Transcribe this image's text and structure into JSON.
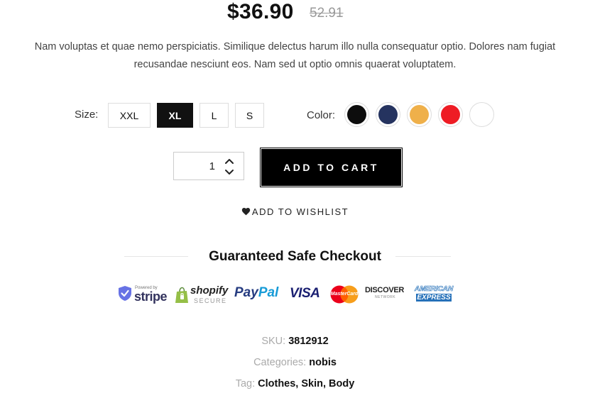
{
  "price": {
    "current": "$36.90",
    "original": "52.91"
  },
  "description": "Nam voluptas et quae nemo perspiciatis. Similique delectus harum illo nulla consequatur optio. Dolores nam fugiat recusandae nesciunt eos. Nam sed ut optio omnis quaerat voluptatem.",
  "size": {
    "label": "Size:",
    "options": [
      "XXL",
      "XL",
      "L",
      "S"
    ],
    "selected": "XL"
  },
  "color": {
    "label": "Color:",
    "swatches": [
      {
        "name": "black",
        "hex": "#0d0d0d"
      },
      {
        "name": "navy",
        "hex": "#25335f"
      },
      {
        "name": "yellow",
        "hex": "#efb04a"
      },
      {
        "name": "red",
        "hex": "#ee1c24"
      },
      {
        "name": "white",
        "hex": "#ffffff"
      }
    ]
  },
  "quantity": {
    "value": "1"
  },
  "buttons": {
    "add_to_cart": "ADD TO CART",
    "wishlist": "ADD TO WISHLIST"
  },
  "checkout": {
    "title": "Guaranteed Safe Checkout",
    "badges": {
      "stripe_small": "Powered by",
      "stripe": "stripe",
      "shopify": "shopify",
      "shopify_secure": "SECURE",
      "paypal_pay": "Pay",
      "paypal_pal": "Pal",
      "visa": "VISA",
      "mastercard": "MasterCard",
      "discover": "DISCOVER",
      "discover_network": "NETWORK",
      "amex_top": "AMERICAN",
      "amex_bottom": "EXPRESS"
    }
  },
  "meta": {
    "sku_label": "SKU:",
    "sku_value": "3812912",
    "categories_label": "Categories:",
    "categories_value": "nobis",
    "tag_label": "Tag:",
    "tag_value": "Clothes, Skin, Body"
  }
}
